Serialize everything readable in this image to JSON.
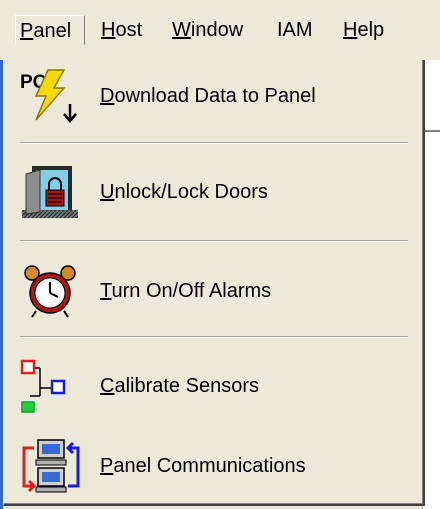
{
  "menubar": {
    "items": [
      {
        "label": "Panel",
        "accel": "P",
        "rest": "anel"
      },
      {
        "label": "Host",
        "accel": "H",
        "rest": "ost"
      },
      {
        "label": "Window",
        "accel": "W",
        "rest": "indow"
      },
      {
        "label": "IAM",
        "accel": "",
        "rest": "IAM"
      },
      {
        "label": "Help",
        "accel": "H",
        "rest": "elp"
      }
    ]
  },
  "panel_menu": {
    "items": [
      {
        "label": "Download Data to Panel",
        "accel": "D",
        "rest": "ownload Data to Panel",
        "icon": "download-to-panel-icon"
      },
      {
        "label": "Unlock/Lock Doors",
        "accel": "U",
        "rest": "nlock/Lock Doors",
        "icon": "door-lock-icon"
      },
      {
        "label": "Turn On/Off Alarms",
        "accel": "T",
        "rest": "urn On/Off Alarms",
        "icon": "alarm-clock-icon"
      },
      {
        "label": "Calibrate Sensors",
        "accel": "C",
        "rest": "alibrate Sensors",
        "icon": "sensor-network-icon"
      },
      {
        "label": "Panel Communications",
        "accel": "P",
        "rest": "anel Communications",
        "icon": "computers-communication-icon"
      }
    ],
    "icon_text": {
      "pc": "PC"
    }
  },
  "colors": {
    "menu_bg": "#ece9d8",
    "lightning": "#f5d90a",
    "sensor_red": "#e02020",
    "sensor_blue": "#1a1ae0",
    "sensor_green": "#20d040"
  }
}
